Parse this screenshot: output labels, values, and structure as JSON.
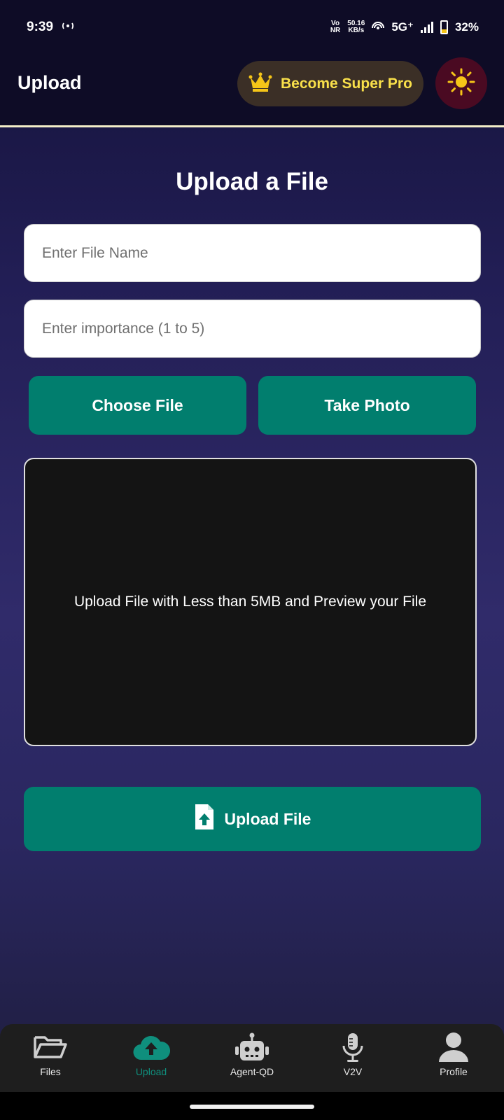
{
  "status_bar": {
    "time": "9:39",
    "network_rate_value": "50.16",
    "network_rate_unit": "KB/s",
    "vo_top": "Vo",
    "vo_bottom": "NR",
    "network_type": "5G⁺",
    "battery": "32%",
    "battery_level": 0.32
  },
  "header": {
    "title": "Upload",
    "pro_button_label": "Become Super Pro",
    "pro_icon": "crown-icon",
    "theme_icon": "sun-icon"
  },
  "form": {
    "title": "Upload a File",
    "file_name_placeholder": "Enter File Name",
    "file_name_value": "",
    "importance_placeholder": "Enter importance (1 to 5)",
    "importance_value": "",
    "choose_file_label": "Choose File",
    "take_photo_label": "Take Photo",
    "preview_text": "Upload File with Less than 5MB and Preview your File",
    "upload_button_label": "Upload File",
    "upload_icon": "file-upload-icon"
  },
  "bottom_nav": {
    "items": [
      {
        "label": "Files",
        "icon": "folder-open-icon",
        "active": false
      },
      {
        "label": "Upload",
        "icon": "cloud-upload-icon",
        "active": true
      },
      {
        "label": "Agent-QD",
        "icon": "robot-icon",
        "active": false
      },
      {
        "label": "V2V",
        "icon": "microphone-icon",
        "active": false
      },
      {
        "label": "Profile",
        "icon": "user-icon",
        "active": false
      }
    ]
  },
  "colors": {
    "accent_teal": "#017e6e",
    "active_nav": "#0f8f7d",
    "pro_text": "#f9e04a",
    "sun": "#f5c518"
  }
}
